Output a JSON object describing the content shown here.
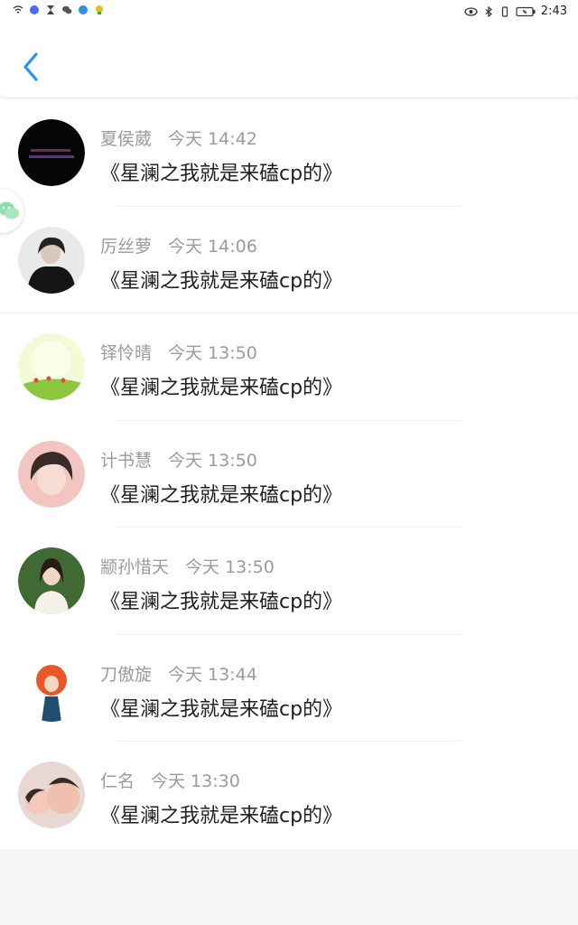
{
  "status_bar": {
    "time": "2:43",
    "battery": "■"
  },
  "colors": {
    "accent": "#2196f3",
    "wechat_green": "#8fdcab"
  },
  "messages": [
    {
      "name": "夏侯葳",
      "time": "今天 14:42",
      "text": "《星澜之我就是来磕cp的》"
    },
    {
      "name": "厉丝萝",
      "time": "今天 14:06",
      "text": "《星澜之我就是来磕cp的》"
    },
    {
      "name": "铎怜晴",
      "time": "今天 13:50",
      "text": "《星澜之我就是来磕cp的》"
    },
    {
      "name": "计书慧",
      "time": "今天 13:50",
      "text": "《星澜之我就是来磕cp的》"
    },
    {
      "name": "颛孙惜天",
      "time": "今天 13:50",
      "text": "《星澜之我就是来磕cp的》"
    },
    {
      "name": "刀傲旋",
      "time": "今天 13:44",
      "text": "《星澜之我就是来磕cp的》"
    },
    {
      "name": "仁名",
      "time": "今天 13:30",
      "text": "《星澜之我就是来磕cp的》"
    }
  ]
}
